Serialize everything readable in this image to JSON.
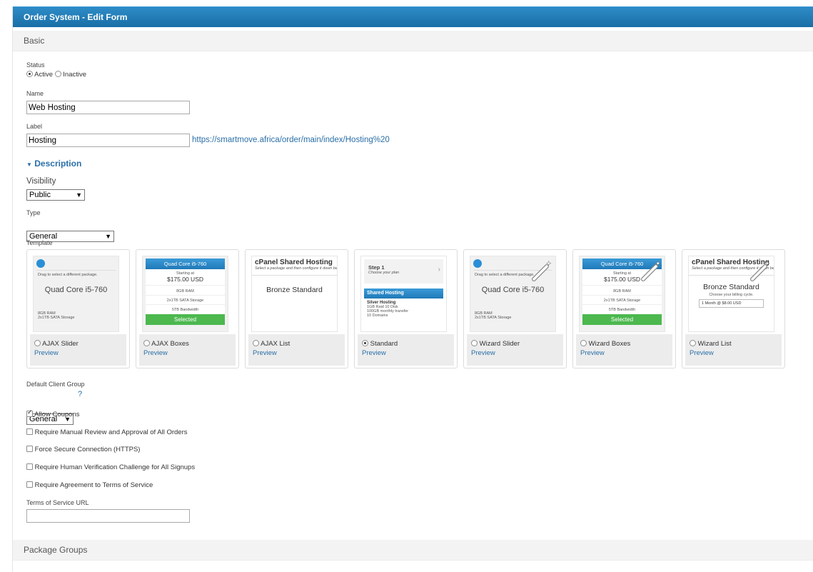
{
  "window": {
    "title": "Order System - Edit Form"
  },
  "sections": {
    "basic": "Basic",
    "package_groups": "Package Groups"
  },
  "status": {
    "label": "Status",
    "options": [
      "Active",
      "Inactive"
    ],
    "selected": "Active"
  },
  "name": {
    "label": "Name",
    "value": "Web Hosting"
  },
  "label_field": {
    "label": "Label",
    "value": "Hosting",
    "url": "https://smartmove.africa/order/main/index/Hosting%20"
  },
  "description": {
    "toggle_label": "Description"
  },
  "visibility": {
    "label": "Visibility",
    "value": "Public"
  },
  "type": {
    "label": "Type",
    "value": "General"
  },
  "template": {
    "label": "Template",
    "preview_label": "Preview",
    "selected": "Standard",
    "items": [
      {
        "name": "AJAX Slider"
      },
      {
        "name": "AJAX Boxes"
      },
      {
        "name": "AJAX List"
      },
      {
        "name": "Standard"
      },
      {
        "name": "Wizard Slider"
      },
      {
        "name": "Wizard Boxes"
      },
      {
        "name": "Wizard List"
      }
    ],
    "thumb_text": {
      "slider_hint": "Drag to select a different package.",
      "slider_title": "Quad Core i5-760",
      "slider_spec1": "8GB RAM",
      "slider_spec2": "2x1TB SATA Storage",
      "boxes_head": "Quad Core i5-760",
      "boxes_starting": "Starting at",
      "boxes_price": "$175.00 USD",
      "boxes_spec1": "8GB RAM",
      "boxes_spec2": "2x1TB SATA Storage",
      "boxes_spec3": "5TB Bandwidth",
      "boxes_selected": "Selected",
      "list_title": "cPanel Shared Hosting",
      "list_sub": "Select a package and then configure it down below.",
      "list_plan": "Bronze Standard",
      "list_cycle_label": "Choose your billing cycle.",
      "list_cycle_value": "1 Month @ $8.00 USD",
      "std_step": "Step 1",
      "std_choose": "Choose your plan",
      "std_bar": "Shared Hosting",
      "std_plan": "Silver Hosting",
      "std_spec1": "1GB Raid 10 Disk",
      "std_spec2": "100GB monthly transfer",
      "std_spec3": "10 Domains"
    }
  },
  "default_client_group": {
    "label": "Default Client Group",
    "value": "General",
    "help": "?"
  },
  "options": [
    {
      "label": "Allow Coupons",
      "checked": true
    },
    {
      "label": "Require Manual Review and Approval of All Orders",
      "checked": false
    },
    {
      "label": "Force Secure Connection (HTTPS)",
      "checked": false
    },
    {
      "label": "Require Human Verification Challenge for All Signups",
      "checked": false
    },
    {
      "label": "Require Agreement to Terms of Service",
      "checked": false
    }
  ],
  "tos_url": {
    "label": "Terms of Service URL",
    "value": ""
  },
  "colors": {
    "accent": "#1a6ea6",
    "link": "#2a6fa8",
    "selected_green": "#4cb84e"
  }
}
